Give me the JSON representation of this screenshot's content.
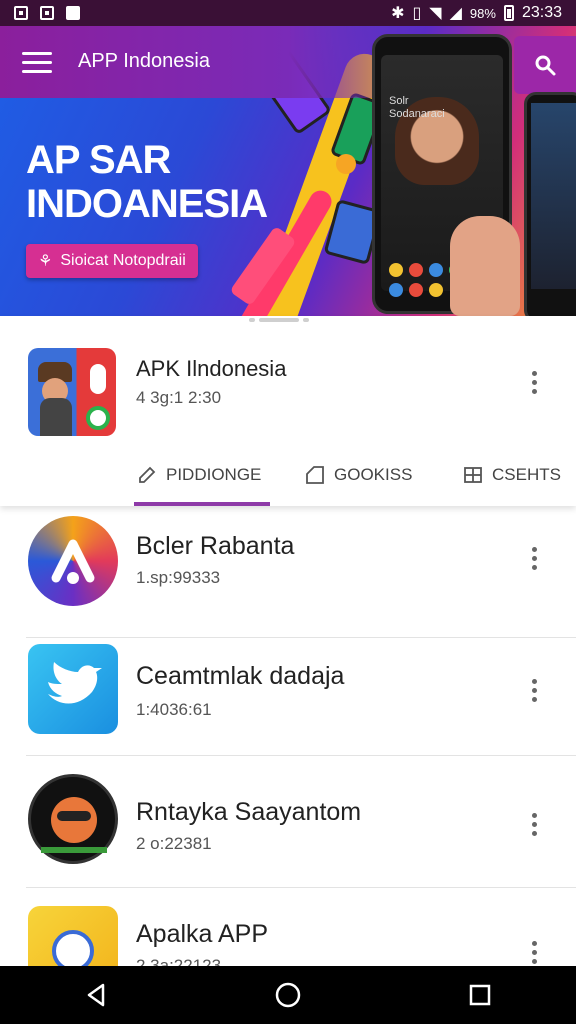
{
  "status_bar": {
    "battery": "98%",
    "time": "23:33"
  },
  "toolbar": {
    "title": "APP Indonesia"
  },
  "hero": {
    "title_line1": "AP SAR",
    "title_line2": "INDOANESIA",
    "button_label": "Sioicat Notopdraii",
    "phone_text": "Solr\nSodanaraci"
  },
  "app": {
    "name": "APK Ilndonesia",
    "meta": "4 3g:1 2:30"
  },
  "tabs": [
    {
      "label": "PIDDIONGE",
      "icon": "pencil-icon"
    },
    {
      "label": "GOOKISS",
      "icon": "tag-icon"
    },
    {
      "label": "CSEHTS",
      "icon": "grid-icon"
    }
  ],
  "list": [
    {
      "title": "Bcler Rabanta",
      "meta": "1.sp:99333"
    },
    {
      "title": "Ceamtmlak dadaja",
      "meta": "1:4036:61"
    },
    {
      "title": "Rntayka Saayantom",
      "meta": "2 o:22381"
    },
    {
      "title": "Apalka APP",
      "meta": "2 3a:22123"
    }
  ],
  "colors": {
    "accent": "#8e3aa8",
    "status_bar": "#3a1036",
    "toolbar": "#8b1f9c"
  }
}
